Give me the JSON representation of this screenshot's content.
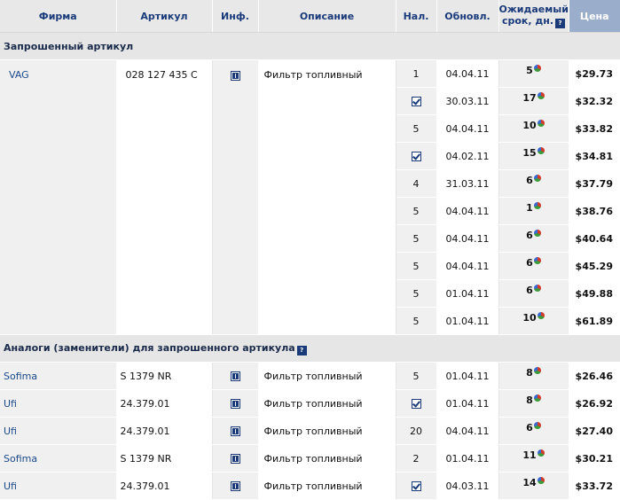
{
  "headers": {
    "firm": "Фирма",
    "article": "Артикул",
    "info": "Инф.",
    "description": "Описание",
    "availability": "Нал.",
    "updated": "Обновл.",
    "expected_line1": "Ожидаемый",
    "expected_line2": "срок, дн.",
    "price": "Цена"
  },
  "section_requested": "Запрошенный артикул",
  "requested": {
    "brand": "VAG",
    "article": "028 127 435 C",
    "description": "Фильтр топливный",
    "rows": [
      {
        "qty": "1",
        "check": false,
        "updated": "04.04.11",
        "days": "5",
        "price": "$29.73"
      },
      {
        "qty": "",
        "check": true,
        "updated": "30.03.11",
        "days": "17",
        "price": "$32.32"
      },
      {
        "qty": "5",
        "check": false,
        "updated": "04.04.11",
        "days": "10",
        "price": "$33.82"
      },
      {
        "qty": "",
        "check": true,
        "updated": "04.02.11",
        "days": "15",
        "price": "$34.81"
      },
      {
        "qty": "4",
        "check": false,
        "updated": "31.03.11",
        "days": "6",
        "price": "$37.79"
      },
      {
        "qty": "5",
        "check": false,
        "updated": "04.04.11",
        "days": "1",
        "price": "$38.76"
      },
      {
        "qty": "5",
        "check": false,
        "updated": "04.04.11",
        "days": "6",
        "price": "$40.64"
      },
      {
        "qty": "5",
        "check": false,
        "updated": "04.04.11",
        "days": "6",
        "price": "$45.29"
      },
      {
        "qty": "5",
        "check": false,
        "updated": "01.04.11",
        "days": "6",
        "price": "$49.88"
      },
      {
        "qty": "5",
        "check": false,
        "updated": "01.04.11",
        "days": "10",
        "price": "$61.89"
      }
    ]
  },
  "section_analogs": "Аналоги (заменители) для запрошенного артикула",
  "analogs": [
    {
      "brand": "Sofima",
      "article": "S 1379 NR",
      "description": "Фильтр топливный",
      "qty": "5",
      "check": false,
      "updated": "01.04.11",
      "days": "8",
      "price": "$26.46"
    },
    {
      "brand": "Ufi",
      "article": "24.379.01",
      "description": "Фильтр топливный",
      "qty": "",
      "check": true,
      "updated": "01.04.11",
      "days": "8",
      "price": "$26.92"
    },
    {
      "brand": "Ufi",
      "article": "24.379.01",
      "description": "Фильтр топливный",
      "qty": "20",
      "check": false,
      "updated": "04.04.11",
      "days": "6",
      "price": "$27.40"
    },
    {
      "brand": "Sofima",
      "article": "S 1379 NR",
      "description": "Фильтр топливный",
      "qty": "2",
      "check": false,
      "updated": "01.04.11",
      "days": "11",
      "price": "$30.21"
    },
    {
      "brand": "Ufi",
      "article": "24.379.01",
      "description": "Фильтр топливный",
      "qty": "",
      "check": true,
      "updated": "04.03.11",
      "days": "14",
      "price": "$33.72"
    }
  ],
  "icons": {
    "info": "info-icon",
    "check": "check-icon",
    "help": "help-icon",
    "days": "pie-chart-icon"
  },
  "colors": {
    "header_text": "#1a3a7a",
    "price_header_bg": "#9aaecb",
    "brand_link": "#1a4a8a"
  }
}
